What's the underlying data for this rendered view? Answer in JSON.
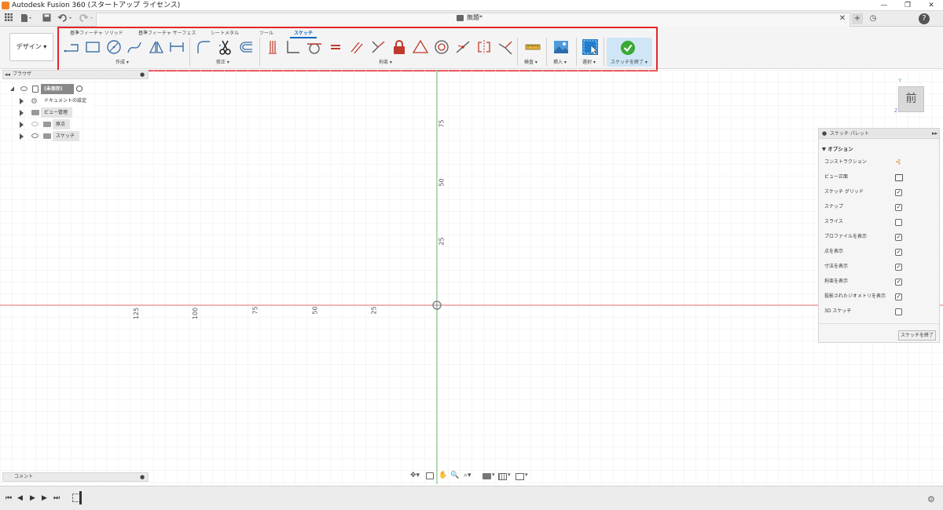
{
  "app": {
    "title": "Autodesk Fusion 360 (スタートアップ ライセンス)"
  },
  "window_controls": {
    "minimize": "—",
    "maximize": "❐",
    "close": "✕"
  },
  "tabs": {
    "document_name": "無題*",
    "close_tab": "✕",
    "new_tab": "+",
    "clock": "◷",
    "help": "?"
  },
  "workspace": {
    "design_label": "デザイン ▾"
  },
  "ribbon": {
    "tabs": [
      "基準フィーチャ ソリッド",
      "基準フィーチャ サーフェス",
      "シートメタル",
      "ツール",
      "スケッチ"
    ],
    "active_tab_index": 4,
    "groups": {
      "create": "作成 ▾",
      "modify": "修正 ▾",
      "constraints": "拘束 ▾",
      "inspect": "検査 ▾",
      "insert": "挿入 ▾",
      "select": "選択 ▾",
      "finish": "スケッチを終了 ▾"
    }
  },
  "browser": {
    "header": "ブラウザ",
    "items": [
      {
        "label": "(未保存)"
      },
      {
        "label": "ドキュメントの設定"
      },
      {
        "label": "ビュー管理"
      },
      {
        "label": "原点"
      },
      {
        "label": "スケッチ"
      }
    ]
  },
  "comment_panel": {
    "label": "コメント"
  },
  "axes": {
    "x_ticks": [
      "125",
      "100",
      "75",
      "50",
      "25"
    ],
    "y_ticks": [
      "75",
      "50",
      "25"
    ]
  },
  "viewcube": {
    "face": "前",
    "axis_y": "Y",
    "axis_z": "Z"
  },
  "palette": {
    "title": "スケッチ パレット",
    "section": "▼ オプション",
    "options": [
      {
        "label": "コンストラクション",
        "control": "icon"
      },
      {
        "label": "ビュー正面",
        "control": "icon"
      },
      {
        "label": "スケッチ グリッド",
        "checked": true
      },
      {
        "label": "スナップ",
        "checked": true
      },
      {
        "label": "スライス",
        "checked": false
      },
      {
        "label": "プロファイルを表示",
        "checked": true
      },
      {
        "label": "点を表示",
        "checked": true
      },
      {
        "label": "寸法を表示",
        "checked": true
      },
      {
        "label": "拘束を表示",
        "checked": true
      },
      {
        "label": "投影されたジオメトリを表示",
        "checked": true
      },
      {
        "label": "3D スケッチ",
        "checked": false
      }
    ],
    "finish_button": "スケッチを終了"
  },
  "colors": {
    "highlight_box": "#e3262c",
    "x_axis": "#e36b6b",
    "y_axis": "#6ec26e",
    "accent": "#0a69c4",
    "finish_green": "#3aa935"
  }
}
